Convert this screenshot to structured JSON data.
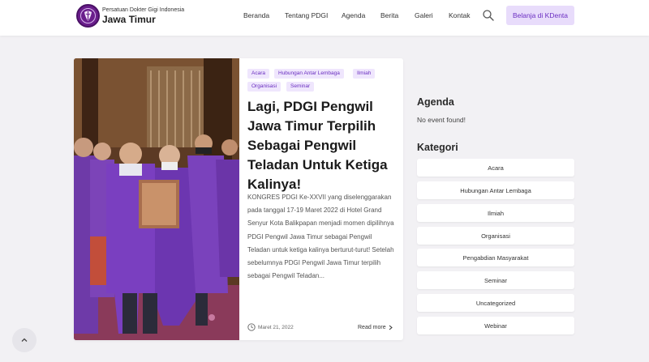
{
  "brand": {
    "small": "Persatuan Dokter Gigi Indonesia",
    "name": "Jawa Timur",
    "logo_icon": "pdgi-logo-icon"
  },
  "nav": {
    "items": [
      "Beranda",
      "Tentang PDGI",
      "Agenda",
      "Berita",
      "Galeri",
      "Kontak"
    ],
    "search_icon": "search-icon",
    "shop_button": "Belanja di KDenta"
  },
  "post": {
    "tags": [
      "Acara",
      "Hubungan Antar Lembaga",
      "Ilmiah",
      "Organisasi",
      "Seminar"
    ],
    "title": "Lagi, PDGI Pengwil Jawa Timur Terpilih Sebagai Pengwil Teladan Untuk Ketiga Kalinya!",
    "excerpt": "KONGRES PDGI Ke-XXVII yang diselenggarakan pada tanggal 17-19 Maret 2022 di Hotel Grand Senyur Kota Balikpapan menjadi momen dipilihnya PDGI Pengwil Jawa Timur sebagai Pengwil Teladan untuk ketiga kalinya berturut-turut! Setelah sebelumnya PDGI Pengwil Jawa Timur terpilih sebagai Pengwil Teladan...",
    "date": "Maret 21, 2022",
    "read_more": "Read more"
  },
  "sidebar": {
    "agenda_title": "Agenda",
    "agenda_empty": "No event found!",
    "kategori_title": "Kategori",
    "categories": [
      "Acara",
      "Hubungan Antar Lembaga",
      "Ilmiah",
      "Organisasi",
      "Pengabdian Masyarakat",
      "Seminar",
      "Uncategorized",
      "Webinar"
    ]
  },
  "colors": {
    "accent": "#6c2fc2",
    "accent_light": "#e8dcfb",
    "background": "#f2f1f4"
  }
}
